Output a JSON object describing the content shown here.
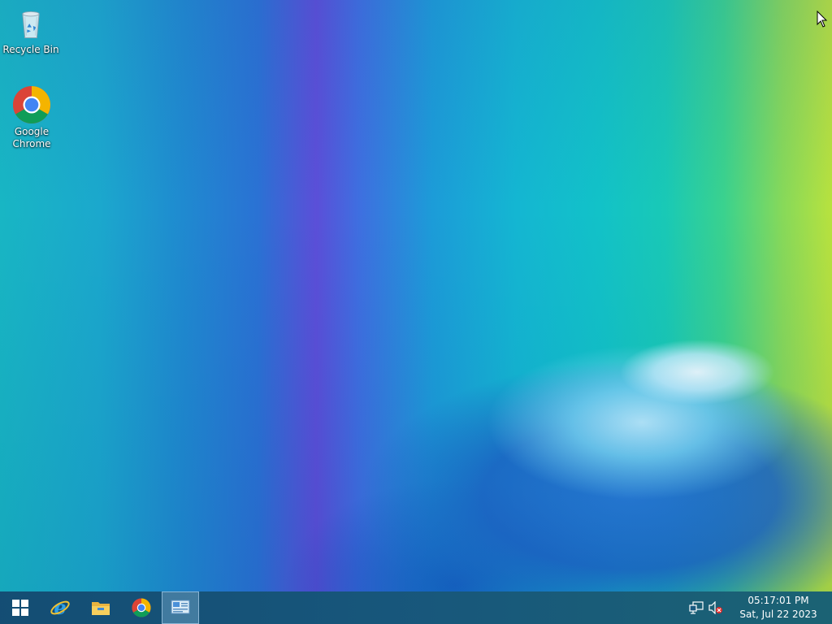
{
  "desktop": {
    "icons": [
      {
        "label": "Recycle Bin",
        "icon": "recycle-bin-icon"
      },
      {
        "label": "Google Chrome",
        "icon": "chrome-icon"
      }
    ]
  },
  "taskbar": {
    "start": {
      "icon": "windows-start-icon"
    },
    "pinned": [
      {
        "icon": "internet-explorer-icon"
      },
      {
        "icon": "file-explorer-icon"
      },
      {
        "icon": "chrome-icon"
      },
      {
        "icon": "control-panel-icon",
        "active": true
      }
    ],
    "tray": {
      "icons": [
        "network-icon",
        "volume-muted-icon"
      ],
      "time": "05:17:01 PM",
      "date": "Sat, Jul 22 2023"
    }
  },
  "colors": {
    "taskbar": "#0e5076",
    "chrome_red": "#db4437",
    "chrome_yellow": "#f4b400",
    "chrome_green": "#0f9d58",
    "chrome_blue": "#4285f4"
  }
}
